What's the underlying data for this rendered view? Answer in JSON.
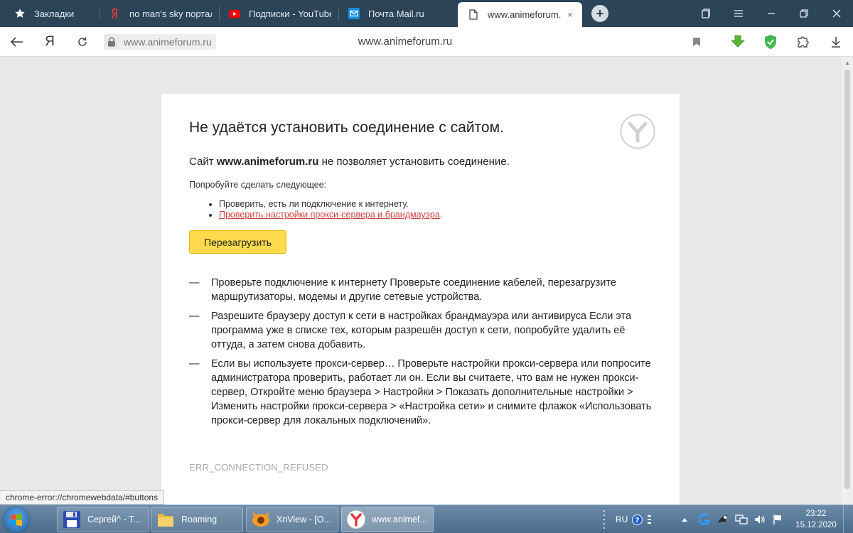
{
  "browser": {
    "tabs": [
      {
        "label": "Закладки",
        "icon": "star-icon",
        "active": false
      },
      {
        "label": "no man's sky портал",
        "icon": "yandex-icon",
        "active": false
      },
      {
        "label": "Подписки - YouTube",
        "icon": "youtube-icon",
        "active": false
      },
      {
        "label": "Почта Mail.ru",
        "icon": "mail-icon",
        "active": false
      },
      {
        "label": "www.animeforum.ru",
        "icon": "page-icon",
        "active": true
      }
    ],
    "tab_close": "×",
    "new_tab": "+",
    "address": {
      "host": "www.animeforum.ru",
      "page_title": "www.animeforum.ru",
      "yandex_logo": "Я"
    }
  },
  "error_page": {
    "title": "Не удаётся установить соединение с сайтом.",
    "lead_prefix": "Сайт ",
    "lead_host": "www.animeforum.ru",
    "lead_suffix": " не позволяет установить соединение.",
    "try_label": "Попробуйте сделать следующее:",
    "try_items": [
      "Проверить, есть ли подключение к интернету.",
      "Проверить настройки прокси-сервера и брандмауэра"
    ],
    "try_items_suffix": ".",
    "reload_label": "Перезагрузить",
    "advice": [
      "Проверьте подключение к интернету Проверьте соединение кабелей, перезагрузите маршрутизаторы, модемы и другие сетевые устройства.",
      "Разрешите браузеру доступ к сети в настройках брандмауэра или антивируса Если эта программа уже в списке тех, которым разрешён доступ к сети, попробуйте удалить её оттуда, а затем снова добавить.",
      "Если вы используете прокси-сервер… Проверьте настройки прокси-сервера или попросите администратора проверить, работает ли он. Если вы считаете, что вам не нужен прокси-сервер, Откройте меню браузера > Настройки > Показать дополнительные настройки > Изменить настройки прокси-сервера > «Настройка сети» и снимите флажок «Использовать прокси-сервер для локальных подключений»."
    ],
    "dash": "—",
    "error_code": "ERR_CONNECTION_REFUSED"
  },
  "status_bar": {
    "url": "chrome-error://chromewebdata/#buttons"
  },
  "taskbar": {
    "tasks": [
      {
        "label": "Сергей^ - Т...",
        "icon": "floppy-icon"
      },
      {
        "label": "Roaming",
        "icon": "folder-icon"
      },
      {
        "label": "XnView - [O...",
        "icon": "xnview-icon"
      },
      {
        "label": "www.animef...",
        "icon": "yandex-browser-icon"
      }
    ],
    "language": "RU",
    "time": "23:22",
    "date": "15.12.2020"
  },
  "colors": {
    "tabstrip": "#2c4458",
    "reload_button": "#ffdb4d",
    "link": "#d23e3e",
    "shield": "#3fb950",
    "download_arrow": "#5cb531"
  }
}
